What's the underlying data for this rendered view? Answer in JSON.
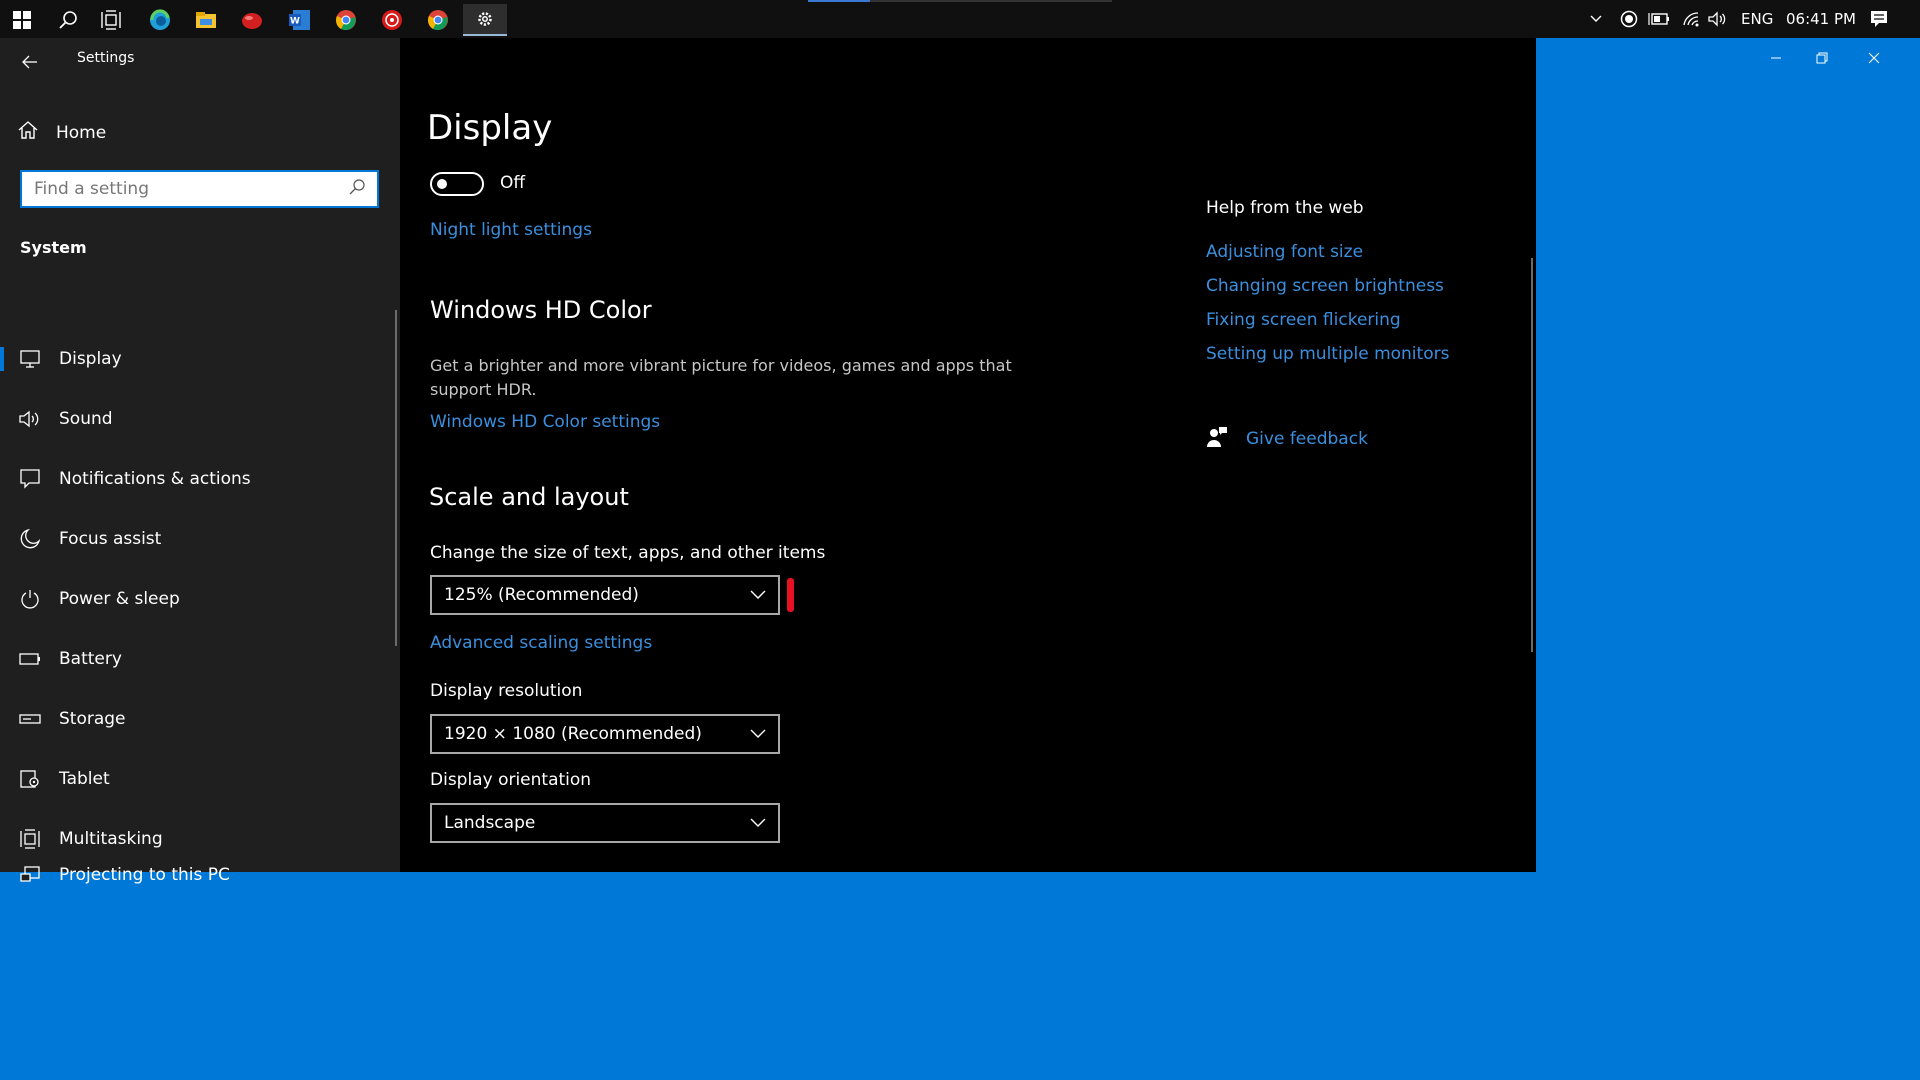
{
  "taskbar": {
    "icons": [
      "windows-start-icon",
      "search-icon",
      "task-view-icon",
      "edge-icon",
      "file-explorer-icon",
      "red-app-icon",
      "word-icon",
      "chrome-icon",
      "red-target-icon",
      "chrome-icon",
      "settings-gear-icon"
    ],
    "tray": {
      "language": "ENG",
      "time": "06:41 PM"
    }
  },
  "window": {
    "app_title": "Settings",
    "home_label": "Home",
    "search_placeholder": "Find a setting",
    "section_label": "System",
    "nav_items": [
      {
        "label": "Display",
        "icon": "monitor-icon",
        "selected": true
      },
      {
        "label": "Sound",
        "icon": "speaker-icon"
      },
      {
        "label": "Notifications & actions",
        "icon": "notification-icon"
      },
      {
        "label": "Focus assist",
        "icon": "moon-icon"
      },
      {
        "label": "Power & sleep",
        "icon": "power-icon"
      },
      {
        "label": "Battery",
        "icon": "battery-icon"
      },
      {
        "label": "Storage",
        "icon": "storage-icon"
      },
      {
        "label": "Tablet",
        "icon": "tablet-icon"
      },
      {
        "label": "Multitasking",
        "icon": "multitasking-icon"
      },
      {
        "label": "Projecting to this PC",
        "icon": "projecting-icon"
      }
    ]
  },
  "main": {
    "title": "Display",
    "night_light": {
      "state_label": "Off",
      "on": false,
      "settings_link": "Night light settings"
    },
    "hd_color": {
      "heading": "Windows HD Color",
      "description": "Get a brighter and more vibrant picture for videos, games and apps that support HDR.",
      "settings_link": "Windows HD Color settings"
    },
    "scale_layout": {
      "heading": "Scale and layout",
      "scale_label": "Change the size of text, apps, and other items",
      "scale_value": "125% (Recommended)",
      "advanced_link": "Advanced scaling settings",
      "resolution_label": "Display resolution",
      "resolution_value": "1920 × 1080 (Recommended)",
      "orientation_label": "Display orientation",
      "orientation_value": "Landscape"
    },
    "help": {
      "title": "Help from the web",
      "links": [
        "Adjusting font size",
        "Changing screen brightness",
        "Fixing screen flickering",
        "Setting up multiple monitors"
      ],
      "feedback_label": "Give feedback"
    }
  },
  "colors": {
    "accent": "#0078d7",
    "link": "#3b8fde",
    "desktop": "#0078d7",
    "marker": "#e81123"
  }
}
